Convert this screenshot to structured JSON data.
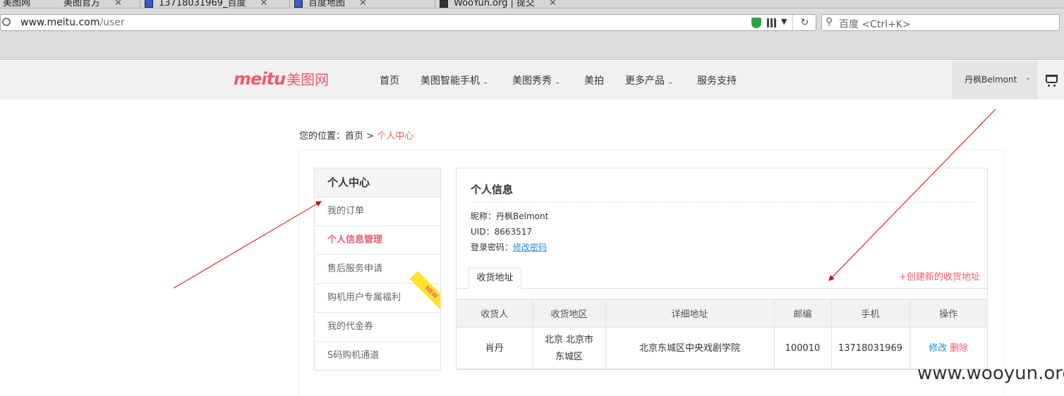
{
  "browser": {
    "tabs": [
      {
        "label": "美图网"
      },
      {
        "label": "美图官方"
      },
      {
        "label": "13718031969_百度"
      },
      {
        "label": "百度地图"
      },
      {
        "label": "WooYun.org | 提交"
      }
    ],
    "url_host": "www.meitu.com",
    "url_path": "/user",
    "search_placeholder": "百度 <Ctrl+K>"
  },
  "site": {
    "logo_text": "meitu",
    "logo_cn": "美图网",
    "nav": [
      {
        "label": "首页"
      },
      {
        "label": "美图智能手机"
      },
      {
        "label": "美图秀秀"
      },
      {
        "label": "美拍"
      },
      {
        "label": "更多产品"
      },
      {
        "label": "服务支持"
      }
    ],
    "user_name": "丹枫Belmont"
  },
  "breadcrumb": {
    "prefix": "您的位置：",
    "home": "首页",
    "sep": ">",
    "current": "个人中心"
  },
  "sidebar": {
    "title": "个人中心",
    "items": [
      {
        "label": "我的订单"
      },
      {
        "label": "个人信息管理"
      },
      {
        "label": "售后服务申请"
      },
      {
        "label": "购机用户专属福利",
        "badge": "NEW"
      },
      {
        "label": "我的代金券"
      },
      {
        "label": "S码购机通道"
      }
    ]
  },
  "profile": {
    "title": "个人信息",
    "nickname_label": "昵称：",
    "nickname": "丹枫Belmont",
    "uid_label": "UID：",
    "uid": "8663517",
    "password_label": "登录密码：",
    "password_link": "修改密码"
  },
  "address": {
    "tab_label": "收货地址",
    "create_link": "+创建新的收货地址",
    "columns": [
      "收货人",
      "收货地区",
      "详细地址",
      "邮编",
      "手机",
      "操作"
    ],
    "rows": [
      {
        "name": "肖丹",
        "region_line1": "北京 北京市",
        "region_line2": "东城区",
        "detail": "北京东城区中央戏剧学院",
        "zip": "100010",
        "phone": "13718031969",
        "edit": "修改",
        "delete": "删除"
      }
    ]
  },
  "watermark": "www.wooyun.org",
  "colors": {
    "brand_pink": "#f05a6a",
    "link_blue": "#2a8ad8",
    "annotation_red": "#d40000"
  }
}
